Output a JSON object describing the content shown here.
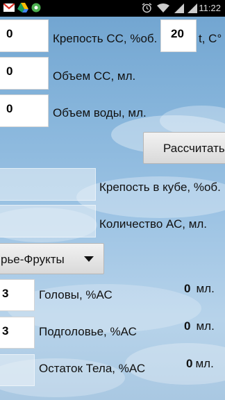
{
  "status_bar": {
    "time": "11:22",
    "left_icons": [
      "gmail-icon",
      "drive-icon",
      "app-icon"
    ],
    "right_icons": [
      "alarm-icon",
      "wifi-icon",
      "signal-icon",
      "signal-icon"
    ]
  },
  "inputs": {
    "strength_ss": {
      "value": "0",
      "label": "Крепость СС, %об."
    },
    "temperature": {
      "value": "20",
      "label": "t, C°"
    },
    "volume_ss": {
      "value": "0",
      "label": "Объем СС, мл."
    },
    "volume_water": {
      "value": "0",
      "label": "Объем воды, мл."
    }
  },
  "calculate_button": "Рассчитать",
  "results": {
    "cube_strength": {
      "value": "",
      "label": "Крепость в кубе, %об."
    },
    "as_quantity": {
      "value": "",
      "label": "Количество АС, мл."
    }
  },
  "raw_material_select": {
    "selected": "рье-Фрукты"
  },
  "fractions": [
    {
      "percent": "3",
      "label": "Головы, %АС",
      "ml_value": "0",
      "ml_unit": "мл."
    },
    {
      "percent": "3",
      "label": "Подголовье, %АС",
      "ml_value": "0",
      "ml_unit": "мл."
    },
    {
      "percent": "",
      "label": "Остаток Тела, %АС",
      "ml_value": "0",
      "ml_unit": "мл."
    }
  ],
  "colors": {
    "sky_top": "#6fa3cf",
    "sky_bottom": "#b7d3ea",
    "field_bg": "#ffffff"
  }
}
